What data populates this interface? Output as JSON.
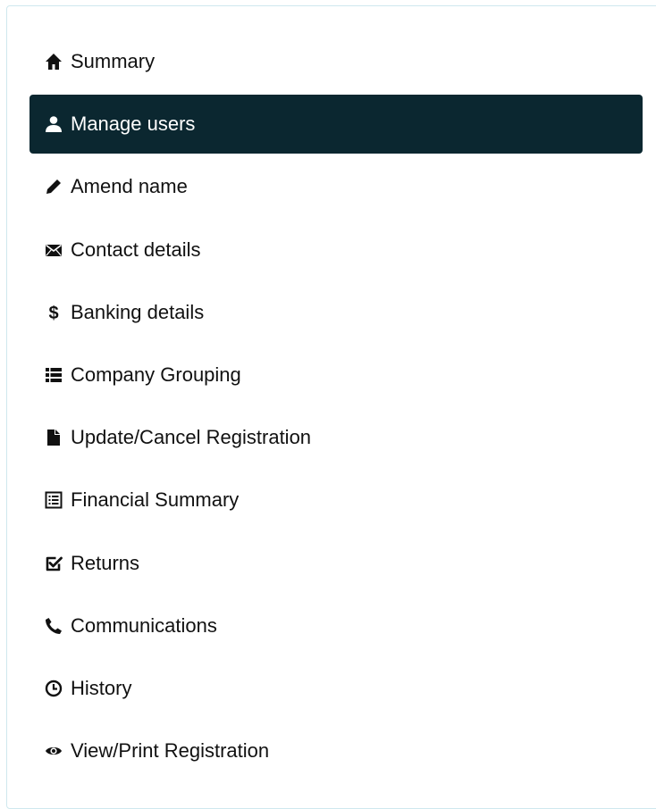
{
  "navigation": {
    "items": [
      {
        "label": "Summary",
        "icon": "home-icon",
        "active": false
      },
      {
        "label": "Manage users",
        "icon": "user-icon",
        "active": true
      },
      {
        "label": "Amend name",
        "icon": "pencil-icon",
        "active": false
      },
      {
        "label": "Contact details",
        "icon": "envelope-icon",
        "active": false
      },
      {
        "label": "Banking details",
        "icon": "dollar-icon",
        "active": false
      },
      {
        "label": "Company Grouping",
        "icon": "list-icon",
        "active": false
      },
      {
        "label": "Update/Cancel Registration",
        "icon": "file-icon",
        "active": false
      },
      {
        "label": "Financial Summary",
        "icon": "list-alt-icon",
        "active": false
      },
      {
        "label": "Returns",
        "icon": "check-square-icon",
        "active": false
      },
      {
        "label": "Communications",
        "icon": "phone-icon",
        "active": false
      },
      {
        "label": "History",
        "icon": "clock-icon",
        "active": false
      },
      {
        "label": "View/Print Registration",
        "icon": "eye-icon",
        "active": false
      }
    ],
    "active_background": "#0b2730",
    "border_color": "#cfe8ee"
  }
}
